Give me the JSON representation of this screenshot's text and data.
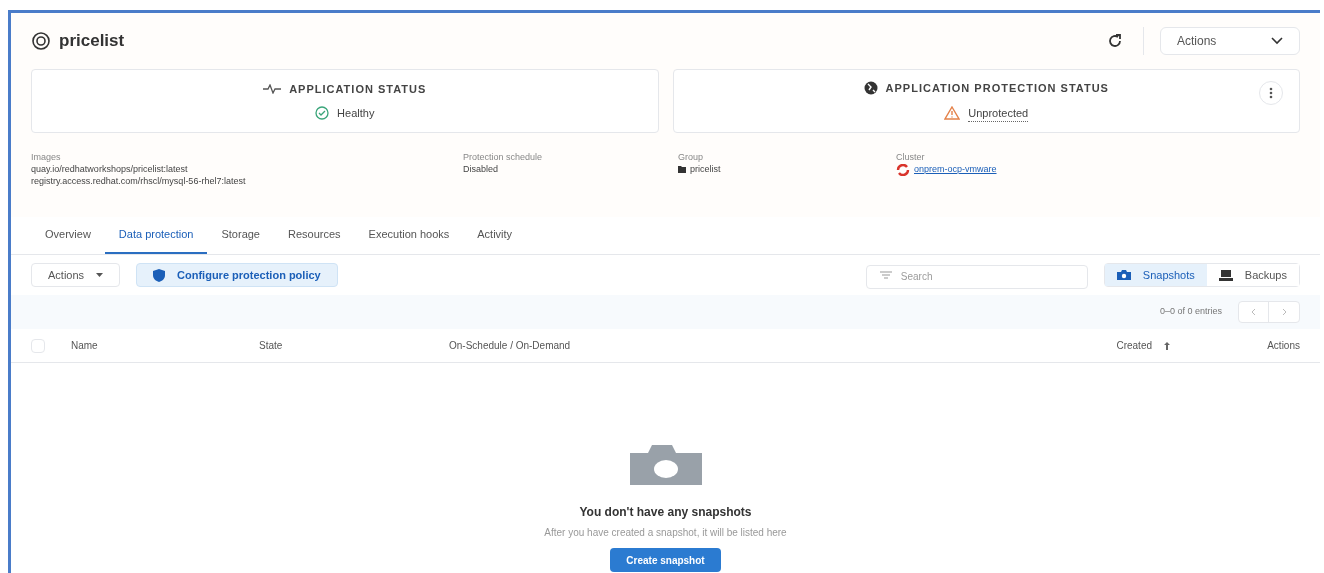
{
  "app": {
    "title": "pricelist",
    "header_actions": "Actions"
  },
  "status_cards": [
    {
      "kind": "health",
      "title": "APPLICATION STATUS",
      "status": "Healthy"
    },
    {
      "kind": "protection",
      "title": "APPLICATION PROTECTION STATUS",
      "status": "Unprotected"
    }
  ],
  "details": [
    {
      "kind": "list",
      "label": "Images",
      "values": [
        "quay.io/redhatworkshops/pricelist:latest",
        "registry.access.redhat.com/rhscl/mysql-56-rhel7:latest"
      ]
    },
    {
      "kind": "text",
      "label": "Protection schedule",
      "values": [
        "Disabled"
      ]
    },
    {
      "kind": "group",
      "label": "Group",
      "values": [
        "pricelist"
      ]
    },
    {
      "kind": "cluster",
      "label": "Cluster",
      "values": [
        "onprem-ocp-vmware"
      ]
    }
  ],
  "tabs": [
    {
      "label": "Overview",
      "selected": false
    },
    {
      "label": "Data protection",
      "selected": true
    },
    {
      "label": "Storage",
      "selected": false
    },
    {
      "label": "Resources",
      "selected": false
    },
    {
      "label": "Execution hooks",
      "selected": false
    },
    {
      "label": "Activity",
      "selected": false
    }
  ],
  "toolbar": {
    "actions": "Actions",
    "configure": "Configure protection policy",
    "search": {
      "placeholder": "Search"
    },
    "toggle": [
      {
        "label": "Snapshots",
        "kind": "camera",
        "selected": true
      },
      {
        "label": "Backups",
        "kind": "drive",
        "selected": false
      }
    ]
  },
  "pagination": {
    "text": "0–0 of 0 entries"
  },
  "table": {
    "select_all": {
      "checked": false
    },
    "columns": [
      "Name",
      "State",
      "On-Schedule / On-Demand",
      "Created",
      "Actions"
    ]
  },
  "empty_state": {
    "title": "You don't have any snapshots",
    "body": "After you have created a snapshot, it will be listed here",
    "button": "Create snapshot"
  }
}
